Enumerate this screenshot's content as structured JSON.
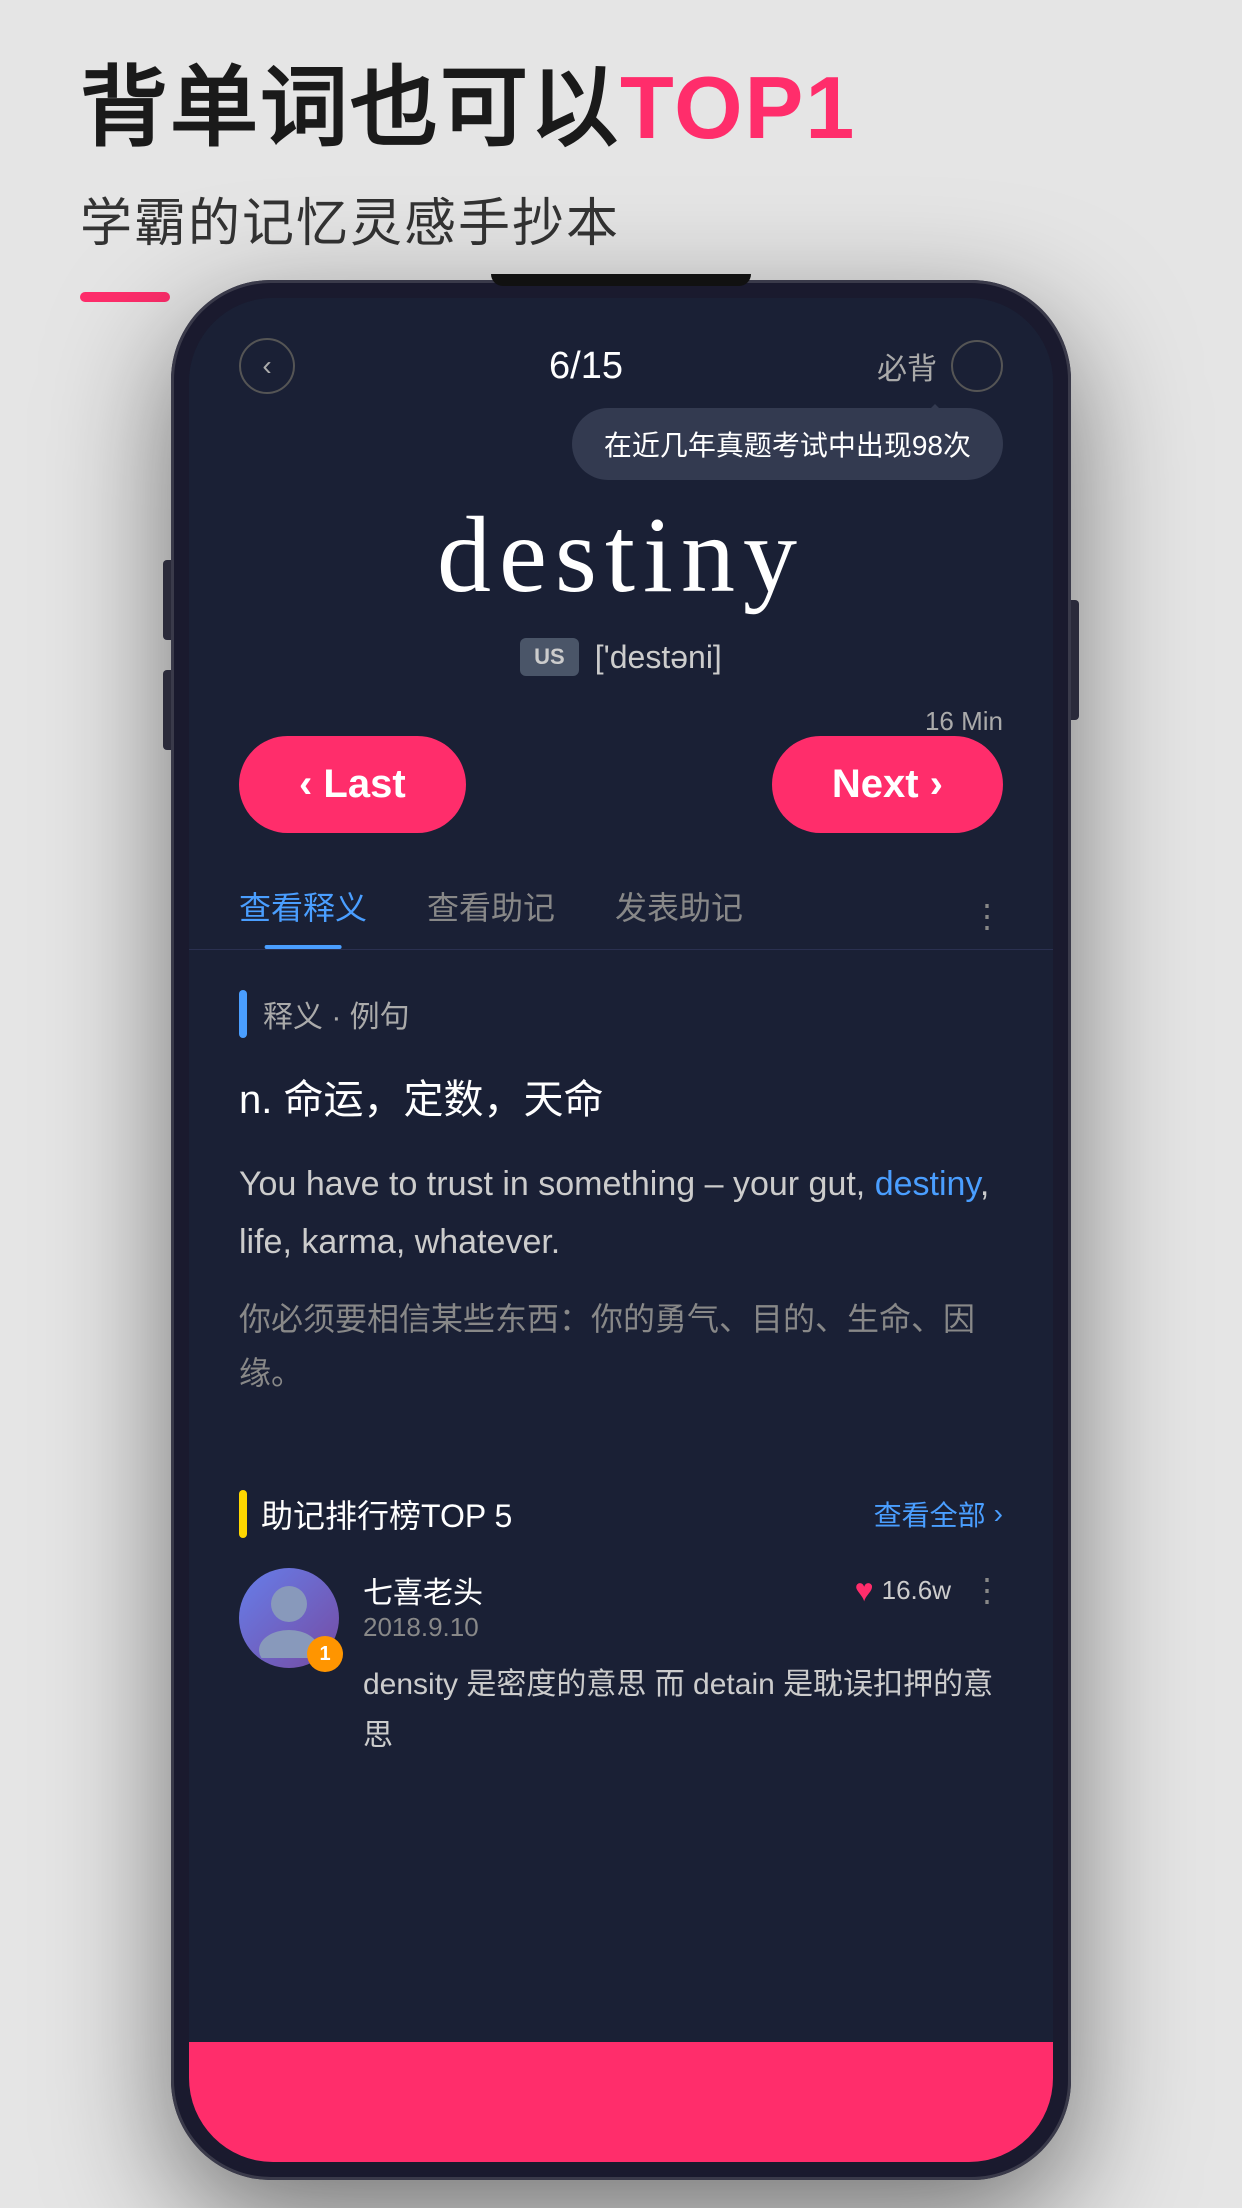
{
  "header": {
    "headline_part1": "背单词也可以",
    "headline_part2": "TOP1",
    "subheadline": "学霸的记忆灵感手抄本"
  },
  "phone": {
    "topbar": {
      "back_label": "‹",
      "progress": "6/15",
      "must_memorize_label": "必背"
    },
    "tooltip": "在近几年真题考试中出现98次",
    "word": {
      "text": "destiny",
      "us_badge": "US",
      "phonetic": "['destəni]"
    },
    "time_hint": "16 Min",
    "buttons": {
      "last_label": "‹ Last",
      "next_label": "Next ›"
    },
    "tabs": [
      {
        "label": "查看释义",
        "active": true
      },
      {
        "label": "查看助记",
        "active": false
      },
      {
        "label": "发表助记",
        "active": false
      }
    ],
    "definition_section": {
      "label": "释义 · 例句",
      "definition": "n.  命运，定数，天命",
      "example_en_parts": [
        {
          "text": "You have to trust in something – your gut, ",
          "highlight": false
        },
        {
          "text": "destiny",
          "highlight": true
        },
        {
          "text": ", life, karma, whatever.",
          "highlight": false
        }
      ],
      "example_zh": "你必须要相信某些东西：你的勇气、目的、生命、因缘。"
    },
    "mnemonic_section": {
      "label": "助记排行榜TOP 5",
      "view_all_label": "查看全部",
      "user": {
        "name": "七喜老头",
        "date": "2018.9.10",
        "rank": "1",
        "likes": "16.6w",
        "content": "density 是密度的意思  而 detain 是耽误扣押的意思"
      }
    }
  }
}
